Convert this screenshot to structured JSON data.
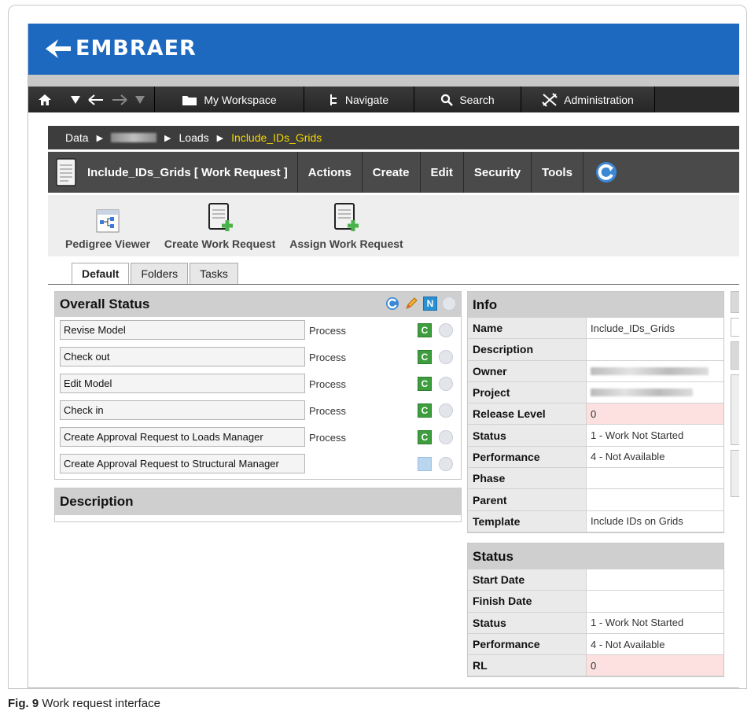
{
  "brand": {
    "name": "EMBRAER"
  },
  "topnav": {
    "items": [
      {
        "label": "My Workspace",
        "icon": "folder-icon"
      },
      {
        "label": "Navigate",
        "icon": "tree-icon"
      },
      {
        "label": "Search",
        "icon": "search-icon"
      },
      {
        "label": "Administration",
        "icon": "tools-icon"
      }
    ]
  },
  "breadcrumb": {
    "root": "Data",
    "level3": "Loads",
    "current": "Include_IDs_Grids"
  },
  "object": {
    "title": "Include_IDs_Grids [ Work Request ]",
    "menus": [
      "Actions",
      "Create",
      "Edit",
      "Security",
      "Tools"
    ]
  },
  "toolbar": {
    "items": [
      "Pedigree Viewer",
      "Create Work Request",
      "Assign Work Request"
    ]
  },
  "tabs": [
    "Default",
    "Folders",
    "Tasks"
  ],
  "overall_status": {
    "title": "Overall Status",
    "header_badge": "N",
    "tasks": [
      {
        "name": "Revise Model",
        "type": "Process",
        "badge": "C"
      },
      {
        "name": "Check out",
        "type": "Process",
        "badge": "C"
      },
      {
        "name": "Edit Model",
        "type": "Process",
        "badge": "C"
      },
      {
        "name": "Check in",
        "type": "Process",
        "badge": "C"
      },
      {
        "name": "Create Approval Request to Loads Manager",
        "type": "Process",
        "badge": "C"
      },
      {
        "name": "Create Approval Request to Structural Manager",
        "type": "",
        "badge": ""
      }
    ]
  },
  "description": {
    "title": "Description"
  },
  "info": {
    "title": "Info",
    "rows": [
      {
        "key": "Name",
        "value": "Include_IDs_Grids"
      },
      {
        "key": "Description",
        "value": ""
      },
      {
        "key": "Owner",
        "value": ""
      },
      {
        "key": "Project",
        "value": ""
      },
      {
        "key": "Release Level",
        "value": "0"
      },
      {
        "key": "Status",
        "value": "1 - Work Not Started"
      },
      {
        "key": "Performance",
        "value": "4 - Not Available"
      },
      {
        "key": "Phase",
        "value": ""
      },
      {
        "key": "Parent",
        "value": ""
      },
      {
        "key": "Template",
        "value": "Include IDs on Grids"
      }
    ]
  },
  "status_panel": {
    "title": "Status",
    "rows": [
      {
        "key": "Start Date",
        "value": ""
      },
      {
        "key": "Finish Date",
        "value": ""
      },
      {
        "key": "Status",
        "value": "1 - Work Not Started"
      },
      {
        "key": "Performance",
        "value": "4 - Not Available"
      },
      {
        "key": "RL",
        "value": "0"
      }
    ]
  },
  "caption": {
    "label": "Fig. 9",
    "text": "Work request interface"
  }
}
